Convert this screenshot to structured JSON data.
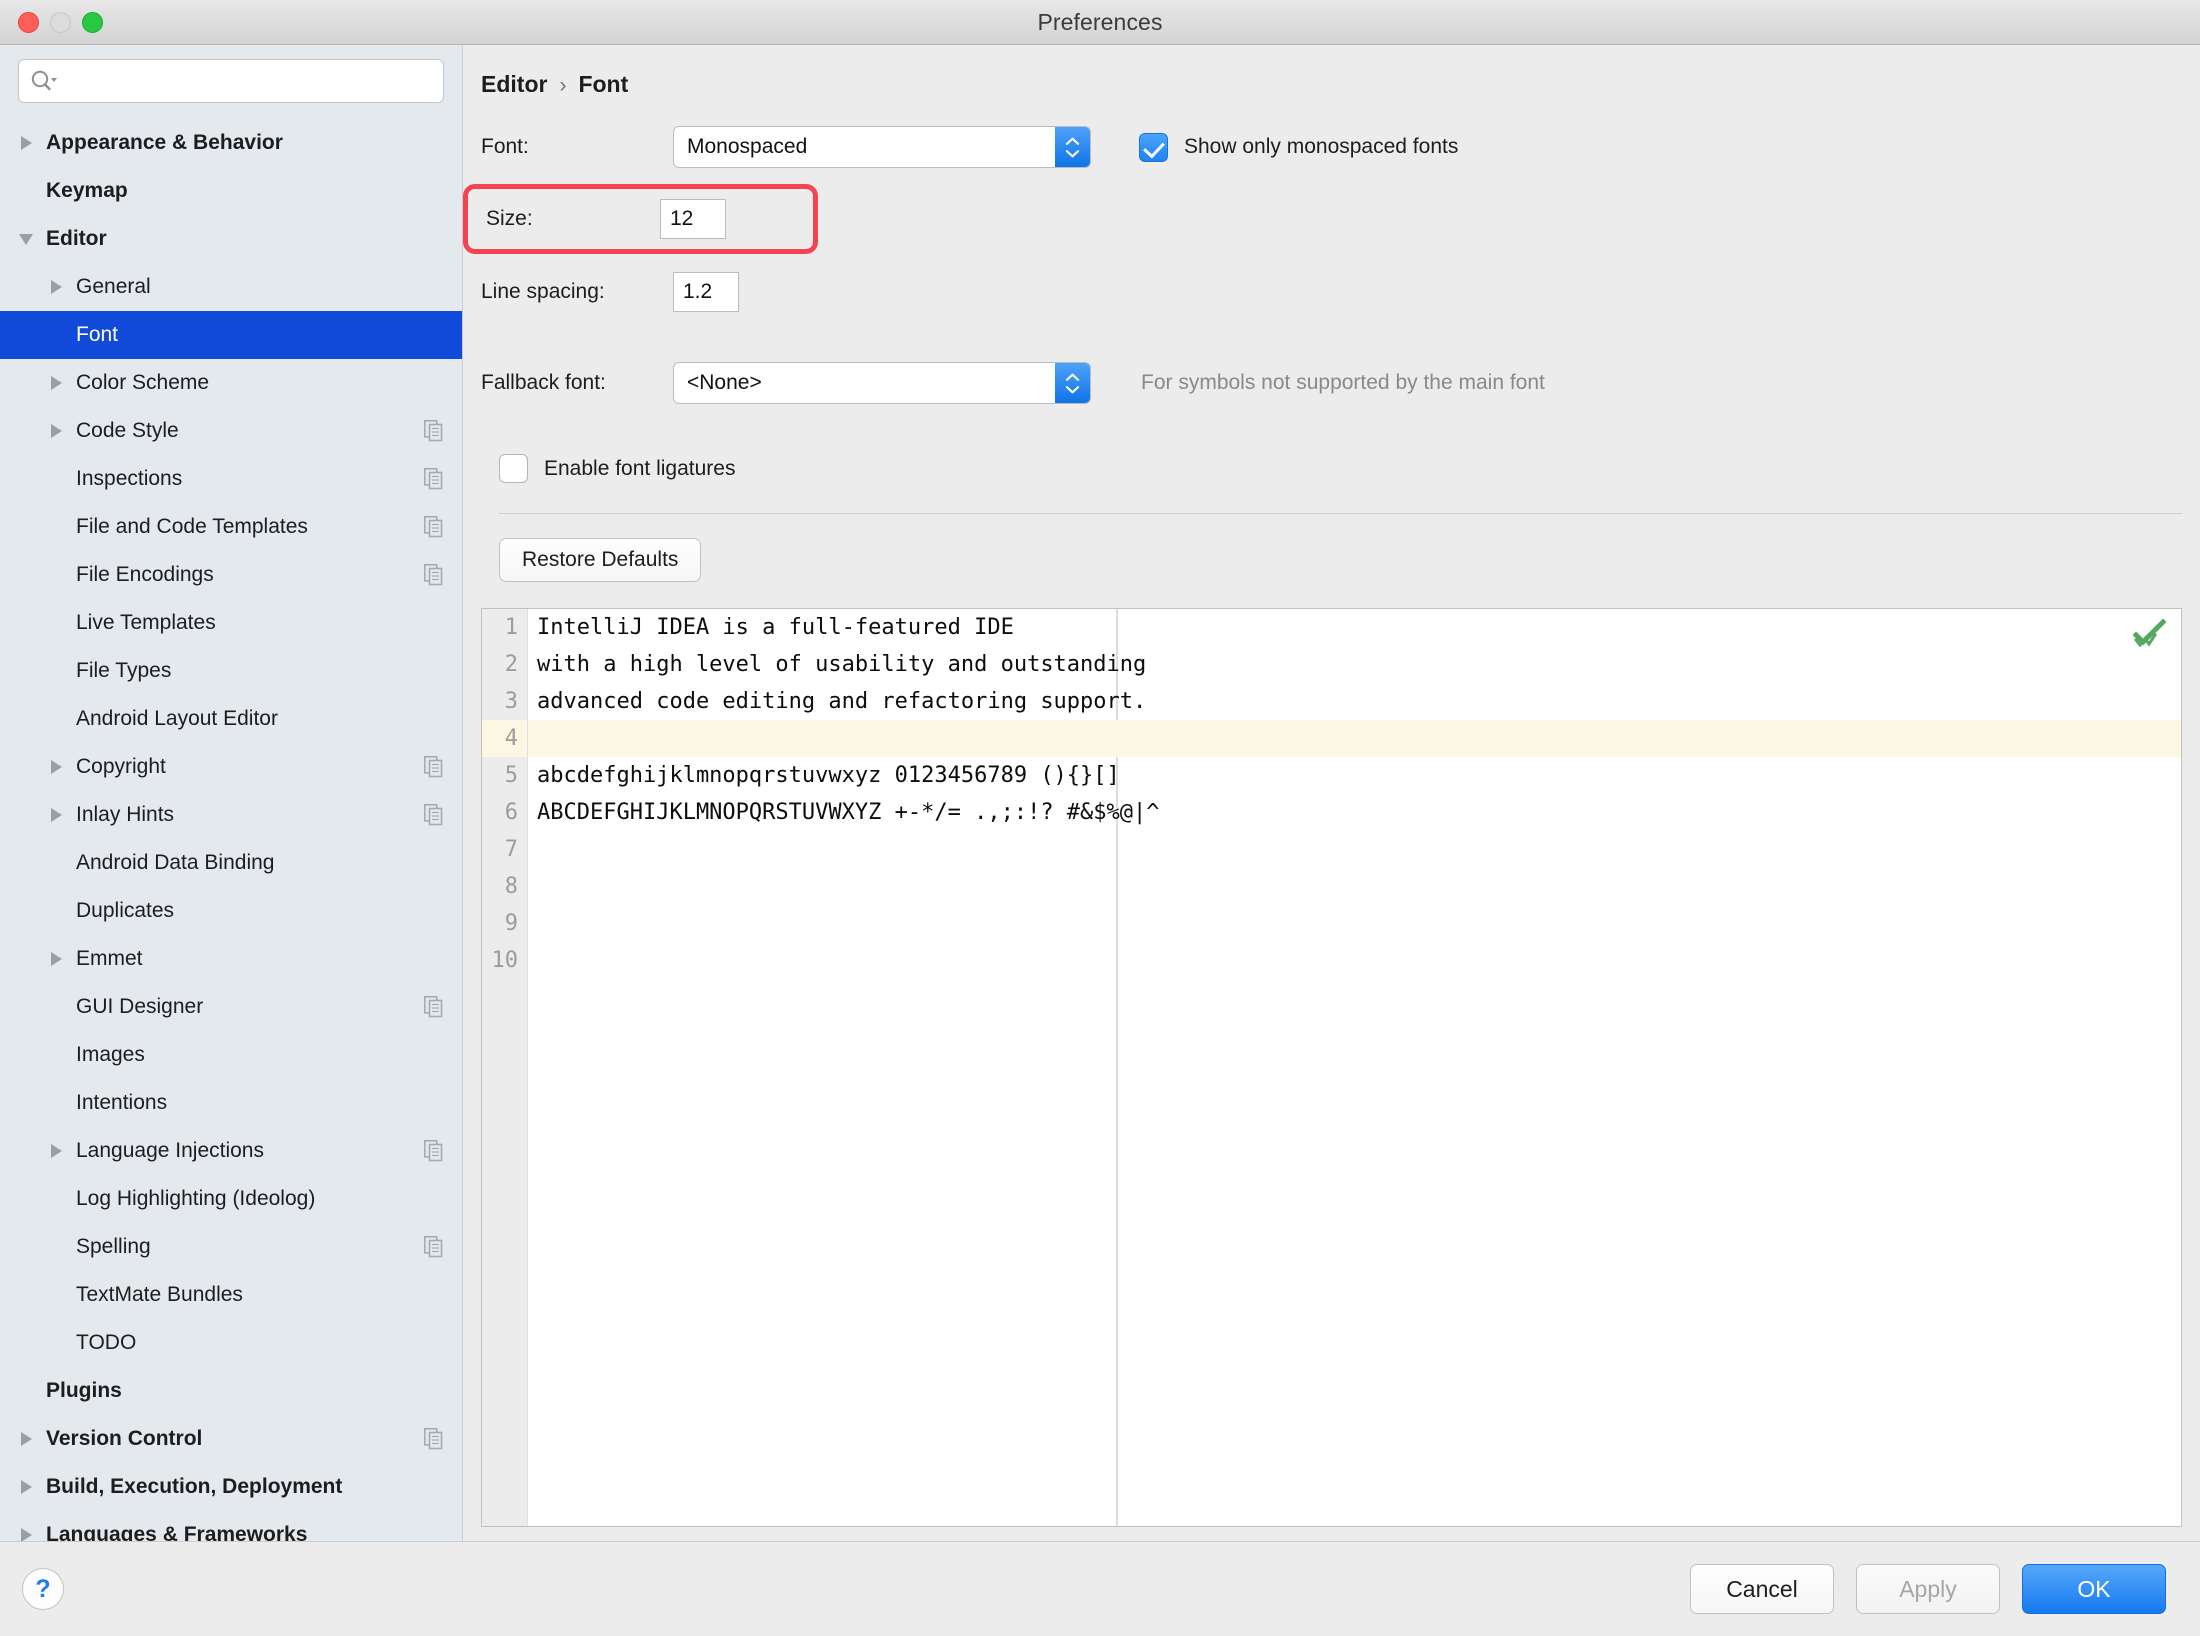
{
  "window": {
    "title": "Preferences",
    "traffic_lights": [
      "close",
      "minimize",
      "maximize"
    ]
  },
  "search": {
    "value": "",
    "placeholder": ""
  },
  "sidebar": {
    "items": [
      {
        "label": "Appearance & Behavior",
        "level": 0,
        "arrow": "right",
        "bold": true,
        "copy": false,
        "selected": false
      },
      {
        "label": "Keymap",
        "level": 0,
        "arrow": "none",
        "bold": true,
        "copy": false,
        "selected": false
      },
      {
        "label": "Editor",
        "level": 0,
        "arrow": "down",
        "bold": true,
        "copy": false,
        "selected": false
      },
      {
        "label": "General",
        "level": 1,
        "arrow": "right",
        "bold": false,
        "copy": false,
        "selected": false
      },
      {
        "label": "Font",
        "level": 1,
        "arrow": "none",
        "bold": false,
        "copy": false,
        "selected": true
      },
      {
        "label": "Color Scheme",
        "level": 1,
        "arrow": "right",
        "bold": false,
        "copy": false,
        "selected": false
      },
      {
        "label": "Code Style",
        "level": 1,
        "arrow": "right",
        "bold": false,
        "copy": true,
        "selected": false
      },
      {
        "label": "Inspections",
        "level": 1,
        "arrow": "none",
        "bold": false,
        "copy": true,
        "selected": false
      },
      {
        "label": "File and Code Templates",
        "level": 1,
        "arrow": "none",
        "bold": false,
        "copy": true,
        "selected": false
      },
      {
        "label": "File Encodings",
        "level": 1,
        "arrow": "none",
        "bold": false,
        "copy": true,
        "selected": false
      },
      {
        "label": "Live Templates",
        "level": 1,
        "arrow": "none",
        "bold": false,
        "copy": false,
        "selected": false
      },
      {
        "label": "File Types",
        "level": 1,
        "arrow": "none",
        "bold": false,
        "copy": false,
        "selected": false
      },
      {
        "label": "Android Layout Editor",
        "level": 1,
        "arrow": "none",
        "bold": false,
        "copy": false,
        "selected": false
      },
      {
        "label": "Copyright",
        "level": 1,
        "arrow": "right",
        "bold": false,
        "copy": true,
        "selected": false
      },
      {
        "label": "Inlay Hints",
        "level": 1,
        "arrow": "right",
        "bold": false,
        "copy": true,
        "selected": false
      },
      {
        "label": "Android Data Binding",
        "level": 1,
        "arrow": "none",
        "bold": false,
        "copy": false,
        "selected": false
      },
      {
        "label": "Duplicates",
        "level": 1,
        "arrow": "none",
        "bold": false,
        "copy": false,
        "selected": false
      },
      {
        "label": "Emmet",
        "level": 1,
        "arrow": "right",
        "bold": false,
        "copy": false,
        "selected": false
      },
      {
        "label": "GUI Designer",
        "level": 1,
        "arrow": "none",
        "bold": false,
        "copy": true,
        "selected": false
      },
      {
        "label": "Images",
        "level": 1,
        "arrow": "none",
        "bold": false,
        "copy": false,
        "selected": false
      },
      {
        "label": "Intentions",
        "level": 1,
        "arrow": "none",
        "bold": false,
        "copy": false,
        "selected": false
      },
      {
        "label": "Language Injections",
        "level": 1,
        "arrow": "right",
        "bold": false,
        "copy": true,
        "selected": false
      },
      {
        "label": "Log Highlighting (Ideolog)",
        "level": 1,
        "arrow": "none",
        "bold": false,
        "copy": false,
        "selected": false
      },
      {
        "label": "Spelling",
        "level": 1,
        "arrow": "none",
        "bold": false,
        "copy": true,
        "selected": false
      },
      {
        "label": "TextMate Bundles",
        "level": 1,
        "arrow": "none",
        "bold": false,
        "copy": false,
        "selected": false
      },
      {
        "label": "TODO",
        "level": 1,
        "arrow": "none",
        "bold": false,
        "copy": false,
        "selected": false
      },
      {
        "label": "Plugins",
        "level": 0,
        "arrow": "none",
        "bold": true,
        "copy": false,
        "selected": false
      },
      {
        "label": "Version Control",
        "level": 0,
        "arrow": "right",
        "bold": true,
        "copy": true,
        "selected": false
      },
      {
        "label": "Build, Execution, Deployment",
        "level": 0,
        "arrow": "right",
        "bold": true,
        "copy": false,
        "selected": false
      },
      {
        "label": "Languages & Frameworks",
        "level": 0,
        "arrow": "right",
        "bold": true,
        "copy": false,
        "selected": false
      }
    ]
  },
  "breadcrumb": {
    "parent": "Editor",
    "separator": "›",
    "current": "Font"
  },
  "form": {
    "font_label": "Font:",
    "font_value": "Monospaced",
    "show_monospaced_label": "Show only monospaced fonts",
    "show_monospaced_checked": true,
    "size_label": "Size:",
    "size_value": "12",
    "line_spacing_label": "Line spacing:",
    "line_spacing_value": "1.2",
    "fallback_label": "Fallback font:",
    "fallback_value": "<None>",
    "fallback_hint": "For symbols not supported by the main font",
    "ligatures_label": "Enable font ligatures",
    "ligatures_checked": false,
    "restore_defaults_label": "Restore Defaults"
  },
  "preview": {
    "line_numbers": [
      "1",
      "2",
      "3",
      "4",
      "5",
      "6",
      "7",
      "8",
      "9",
      "10"
    ],
    "highlighted_line": 4,
    "lines": [
      "IntelliJ IDEA is a full-featured IDE",
      "with a high level of usability and outstanding",
      "advanced code editing and refactoring support.",
      "",
      "abcdefghijklmnopqrstuvwxyz 0123456789 (){}[]",
      "ABCDEFGHIJKLMNOPQRSTUVWXYZ +-*/= .,;:!? #&$%@|^"
    ],
    "status_icon": "double-check-icon"
  },
  "footer": {
    "help_label": "?",
    "cancel_label": "Cancel",
    "apply_label": "Apply",
    "ok_label": "OK"
  },
  "colors": {
    "selection": "#1149d8",
    "highlight_border": "#f4444f",
    "accent_blue": "#1579ef",
    "line_highlight": "#fcf7e3",
    "status_green": "#55a860"
  }
}
